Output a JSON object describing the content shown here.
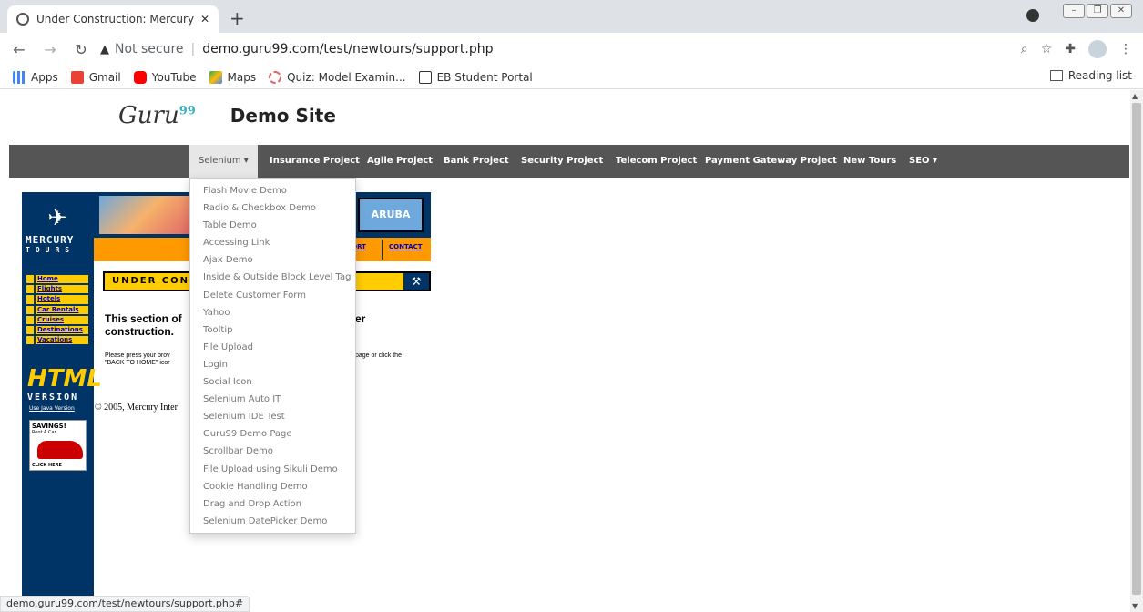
{
  "browser": {
    "tab_title": "Under Construction: Mercury Tou",
    "tab_close": "✕",
    "new_tab": "+",
    "not_secure": "Not secure",
    "url": "demo.guru99.com/test/newtours/support.php",
    "bookmarks": [
      "Apps",
      "Gmail",
      "YouTube",
      "Maps",
      "Quiz: Model Examin...",
      "EB Student Portal"
    ],
    "reading_list": "Reading list",
    "status_url": "demo.guru99.com/test/newtours/support.php#"
  },
  "site": {
    "logo": "Guru",
    "logo_sup": "99",
    "title": "Demo Site"
  },
  "menu": {
    "items": [
      "Selenium ▾",
      "Insurance Project",
      "Agile Project",
      "Bank Project",
      "Security Project",
      "Telecom Project",
      "Payment Gateway Project",
      "New Tours",
      "SEO ▾"
    ]
  },
  "dropdown": {
    "items": [
      "Flash Movie Demo",
      "Radio & Checkbox Demo",
      "Table Demo",
      "Accessing Link",
      "Ajax Demo",
      "Inside & Outside Block Level Tag",
      "Delete Customer Form",
      "Yahoo",
      "Tooltip",
      "File Upload",
      "Login",
      "Social Icon",
      "Selenium Auto IT",
      "Selenium IDE Test",
      "Guru99 Demo Page",
      "Scrollbar Demo",
      "File Upload using Sikuli Demo",
      "Cookie Handling Demo",
      "Drag and Drop Action",
      "Selenium DatePicker Demo"
    ]
  },
  "mercury": {
    "mercury": "MERCURY",
    "tours": "TOURS",
    "nav": [
      "Home",
      "Flights",
      "Hotels",
      "Car Rentals",
      "Cruises",
      "Destinations",
      "Vacations"
    ],
    "html": "HTML",
    "version": "VERSION",
    "java_link": "Use Java Version",
    "ad_title": "SAVINGS!",
    "ad_sub": "Rent A Car",
    "ad_click": "CLICK HERE",
    "aruba": "ARUBA",
    "support": "PORT",
    "contact": "CONTACT",
    "under": "UNDER CONST",
    "heading_left": "This section of",
    "heading_left2": "construction.",
    "heading_right": "er",
    "body_left": "Please press your brov",
    "body_left2": "\"BACK TO HOME\" icor",
    "body_right": "page or click the",
    "copyright": "© 2005, Mercury Inter"
  }
}
